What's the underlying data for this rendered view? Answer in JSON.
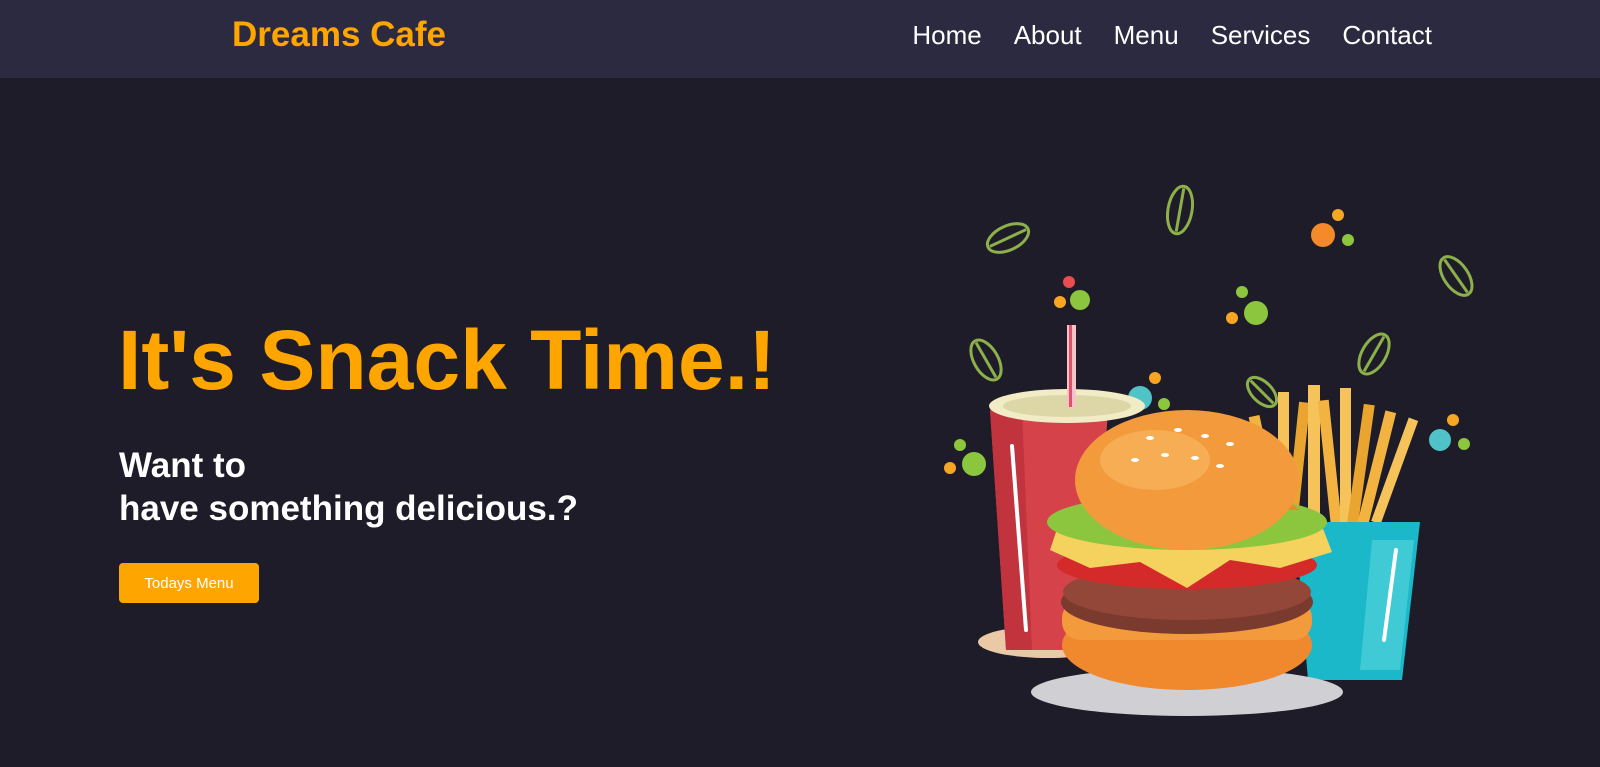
{
  "nav": {
    "brand": "Dreams Cafe",
    "links": [
      "Home",
      "About",
      "Menu",
      "Services",
      "Contact"
    ]
  },
  "hero": {
    "title": "It's Snack Time.!",
    "subtitle_line1": "Want to",
    "subtitle_line2": "have something delicious.?",
    "cta": "Todays Menu"
  },
  "colors": {
    "accent": "#ffa500",
    "background": "#1e1c28",
    "navbar": "#2c2a40",
    "text": "#ffffff"
  },
  "icons": {
    "illustration": "burger-fries-soda-illustration"
  }
}
